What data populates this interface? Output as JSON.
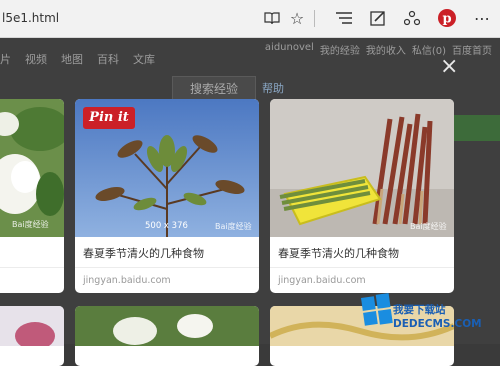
{
  "browser": {
    "address_text": "l5e1.html",
    "icons": [
      "reading-view-icon",
      "favorite-star-icon",
      "hub-icon",
      "web-note-icon",
      "share-icon",
      "pinterest-icon"
    ]
  },
  "page": {
    "nav": [
      "片",
      "视频",
      "地图",
      "百科",
      "文库"
    ],
    "user_links": [
      "aidunovel",
      "我的经验",
      "我的收入",
      "私信(0)",
      "百度首页"
    ],
    "search_button": "搜索经验",
    "help_link": "帮助"
  },
  "overlay": {
    "close_label": "×",
    "pin_label": "Pin it",
    "cards": [
      {
        "title": "春夏季节清火的几种食物",
        "source": "jingyan.baidu.com",
        "dims": "500 x 376",
        "watermark": "Bai度经验"
      },
      {
        "title": "春夏季节清火的几种食物",
        "source": "jingyan.baidu.com",
        "watermark": "Bai度经验"
      }
    ],
    "left_card_watermark": "Bai度经验"
  },
  "watermark": {
    "line1": "我要下载站",
    "line2": "DEDECMS.COM"
  },
  "colors": {
    "pinterest_red": "#cb2027",
    "accent_blue": "#1a5fb4"
  }
}
